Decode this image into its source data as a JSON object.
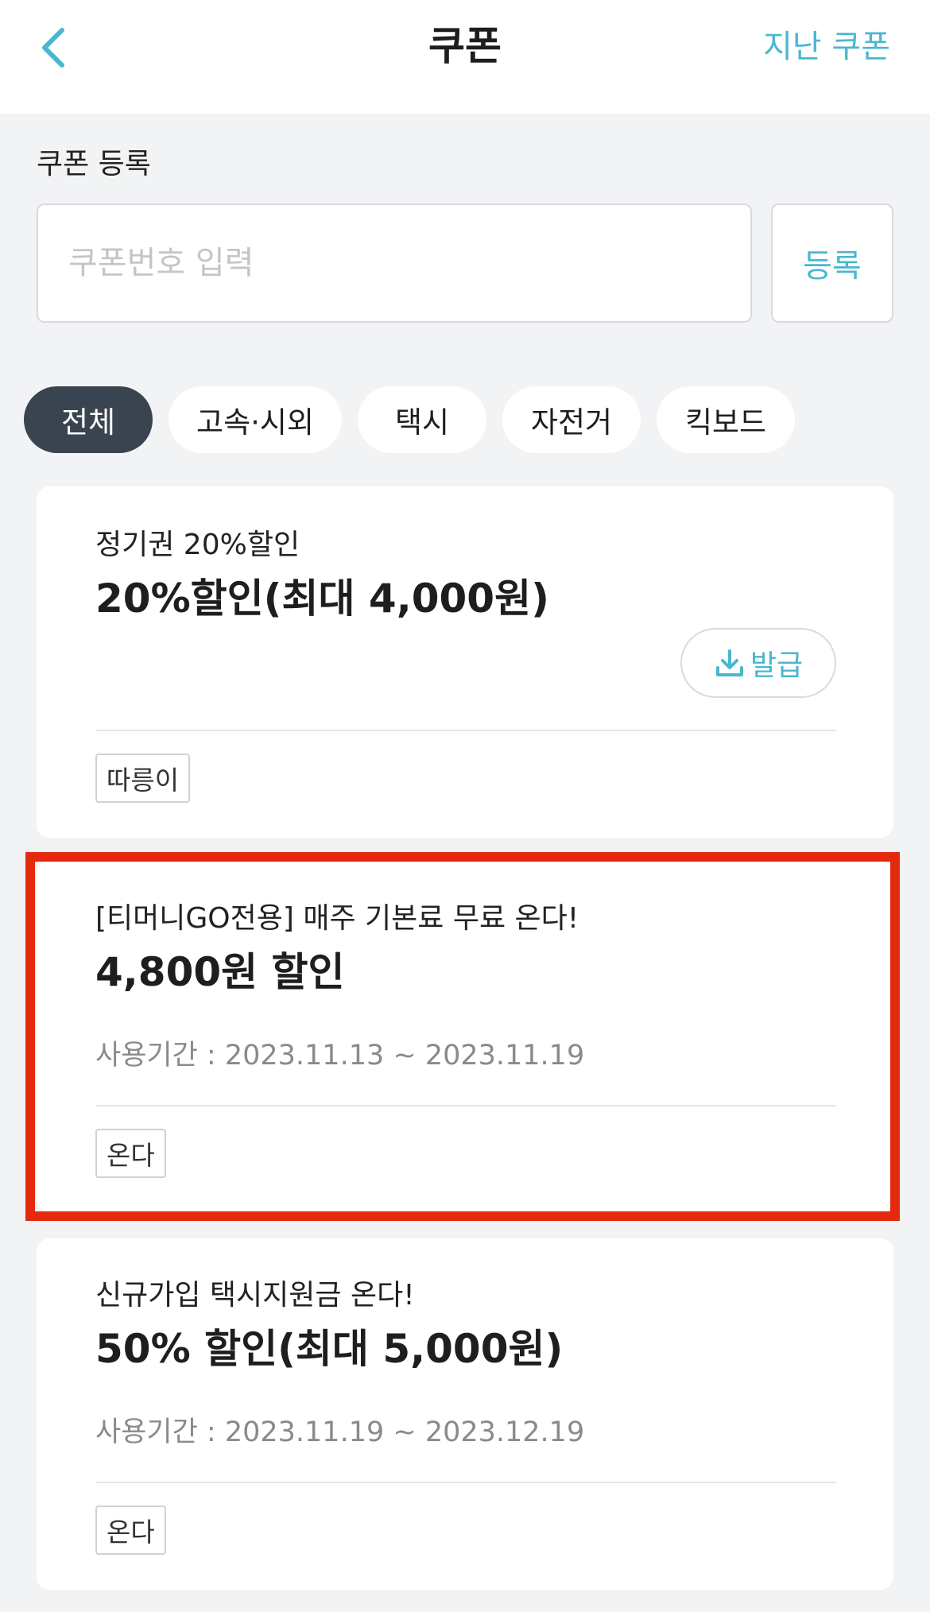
{
  "header": {
    "title": "쿠폰",
    "past_coupons": "지난 쿠폰"
  },
  "register": {
    "label": "쿠폰 등록",
    "placeholder": "쿠폰번호 입력",
    "button": "등록"
  },
  "filters": [
    "전체",
    "고속·시외",
    "택시",
    "자전거",
    "킥보드"
  ],
  "active_filter": "전체",
  "coupons": [
    {
      "subtitle": "정기권 20%할인",
      "title": "20%할인(최대 4,000원)",
      "action": "발급",
      "tag": "따릉이"
    },
    {
      "subtitle": "[티머니GO전용] 매주 기본료 무료 온다!",
      "title": "4,800원 할인",
      "period": "사용기간 : 2023.11.13 ~ 2023.11.19",
      "tag": "온다"
    },
    {
      "subtitle": "신규가입 택시지원금 온다!",
      "title": "50% 할인(최대 5,000원)",
      "period": "사용기간 : 2023.11.19 ~ 2023.12.19",
      "tag": "온다"
    }
  ],
  "colors": {
    "accent": "#4ab7cf",
    "active_chip": "#3a4350",
    "background": "#f2f3f5",
    "highlight": "#e5290f"
  }
}
